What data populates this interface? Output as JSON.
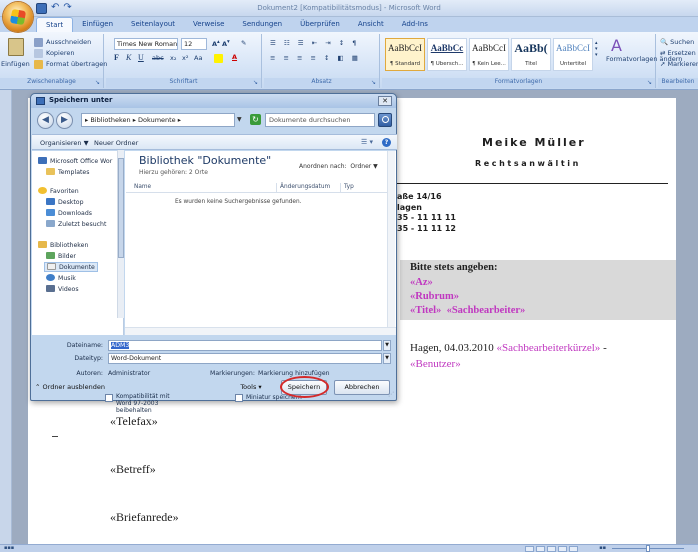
{
  "window": {
    "title": "Dokument2 [Kompatibilitätsmodus] - Microsoft Word"
  },
  "ribbon": {
    "tabs": [
      "Start",
      "Einfügen",
      "Seitenlayout",
      "Verweise",
      "Sendungen",
      "Überprüfen",
      "Ansicht",
      "Add-Ins"
    ],
    "clipboard": {
      "paste": "Einfügen",
      "cut": "Ausschneiden",
      "copy": "Kopieren",
      "format_painter": "Format übertragen",
      "group_label": "Zwischenablage"
    },
    "font": {
      "name": "Times New Roman",
      "size": "12",
      "group_label": "Schriftart"
    },
    "paragraph": {
      "group_label": "Absatz"
    },
    "styles": {
      "items": [
        {
          "sample": "AaBbCcI",
          "name": "¶ Standard"
        },
        {
          "sample": "AaBbCc",
          "name": "¶ Übersch..."
        },
        {
          "sample": "AaBbCcI",
          "name": "¶ Kein Lee..."
        },
        {
          "sample": "AaBb(",
          "name": "Titel"
        },
        {
          "sample": "AaBbCcI",
          "name": "Untertitel"
        }
      ],
      "change": "Formatvorlagen ändern",
      "group_label": "Formatvorlagen"
    },
    "editing": {
      "find": "Suchen",
      "replace": "Ersetzen",
      "select": "Markieren",
      "group_label": "Bearbeiten"
    }
  },
  "document": {
    "name": "Meike Müller",
    "profession": "Rechtsanwältin",
    "address_lines": [
      "aße 14/16",
      "lagen",
      "35 - 11 11 11",
      "35 - 11 11 12"
    ],
    "bitte": "Bitte stets angeben:",
    "az": "«Az»",
    "rubrum": "«Rubrum»",
    "titel": "«Titel»",
    "sachbearbeiter": "«Sachbearbeiter»",
    "date_line": "Hagen,  04.03.2010",
    "sb_kuerzel": "«Sachbearbeiterkürzel»",
    "dash": "-",
    "benutzer": "«Benutzer»",
    "telefax": "«Telefax»",
    "betreff": "«Betreff»",
    "briefanrede": "«Briefanrede»"
  },
  "dialog": {
    "title": "Speichern unter",
    "address": "▸ Bibliotheken ▸ Dokumente ▸",
    "search_placeholder": "Dokumente durchsuchen",
    "organize": "Organisieren ▼",
    "new_folder": "Neuer Ordner",
    "nav_items": [
      "Microsoft Office Wor",
      "Templates",
      "Favoriten",
      "Desktop",
      "Downloads",
      "Zuletzt besucht",
      "Bibliotheken",
      "Bilder",
      "Dokumente",
      "Musik",
      "Videos"
    ],
    "library_title": "Bibliothek \"Dokumente\"",
    "library_sub": "Hierzu gehören: 2 Orte",
    "arrange_label": "Anordnen nach:",
    "arrange_value": "Ordner ▼",
    "columns": [
      "Name",
      "Änderungsdatum",
      "Typ"
    ],
    "empty_message": "Es wurden keine Suchergebnisse gefunden.",
    "filename_label": "Dateiname:",
    "filename_value": "ADM3",
    "filetype_label": "Dateityp:",
    "filetype_value": "Word-Dokument",
    "authors_label": "Autoren:",
    "authors_value": "Administrator",
    "tags_label": "Markierungen:",
    "tags_value": "Markierung hinzufügen",
    "compat_checkbox": "Kompatibilität mit Word 97-2003 beibehalten",
    "thumbnail_checkbox": "Miniatur speichern",
    "hide_folders": "Ordner ausblenden",
    "tools": "Tools",
    "save": "Speichern",
    "cancel": "Abbrechen"
  },
  "colors": {
    "merge_field": "#c038c0",
    "highlight_ring": "#d42a2a"
  }
}
